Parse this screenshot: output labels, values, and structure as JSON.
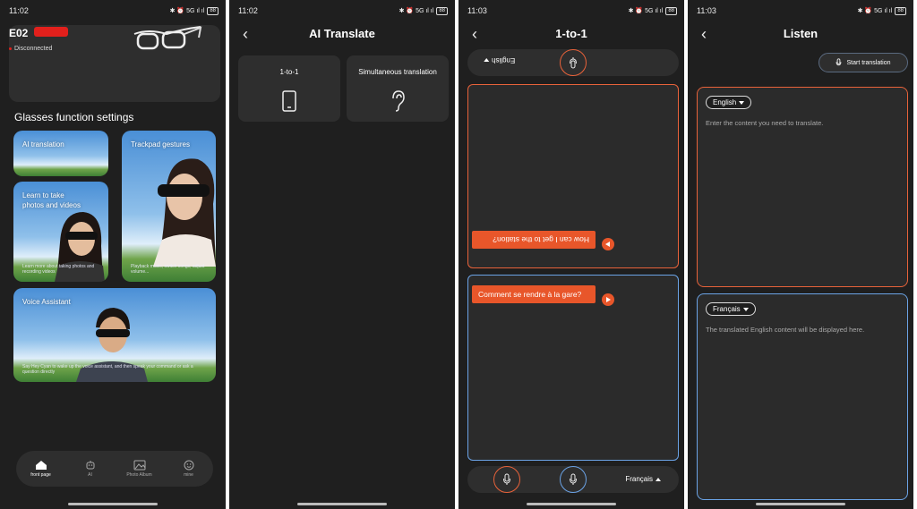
{
  "status": {
    "p1_time": "11:02",
    "p2_time": "11:02",
    "p3_time": "11:03",
    "p4_time": "11:03",
    "icons": "✱ ⏰ 5G ıl ıl",
    "battery": "88"
  },
  "home": {
    "device_name": "E02",
    "device_status": "Disconnected",
    "section_title": "Glasses function settings",
    "tiles": [
      {
        "title": "AI translation",
        "desc": ""
      },
      {
        "title": "Trackpad gestures",
        "desc": "Playback music, switch songs, adjust volume..."
      },
      {
        "title": "Learn to take photos and videos",
        "desc": "Learn more about taking photos and recording videos"
      },
      {
        "title": "Voice Assistant",
        "desc": "Say Hey Cyan to wake up the voice assistant, and then speak your command or ask a question directly"
      }
    ],
    "tabs": [
      "front page",
      "AI",
      "Photo Album",
      "mine"
    ]
  },
  "ai_translate": {
    "title": "AI Translate",
    "modes": [
      "1-to-1",
      "Simultaneous translation"
    ]
  },
  "one_to_one": {
    "title": "1-to-1",
    "top_language": "English",
    "bottom_language": "Français",
    "message_top": "How can I get to the station?",
    "message_bottom": "Comment se rendre à la gare?"
  },
  "listen": {
    "title": "Listen",
    "start_button": "Start translation",
    "source_language": "English",
    "source_placeholder": "Enter the content you need to translate.",
    "target_language": "Français",
    "target_placeholder": "The translated English content will be displayed here."
  },
  "colors": {
    "background": "#1f1f1f",
    "card": "#2e2e2e",
    "accent_orange": "#e8562a",
    "accent_blue": "#6ba3e6"
  }
}
